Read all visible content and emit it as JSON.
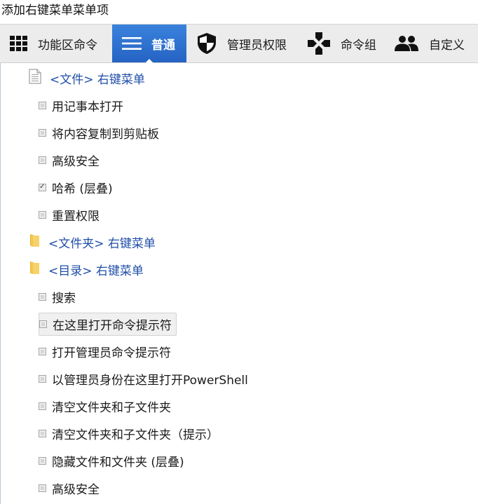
{
  "window": {
    "title": "添加右键菜单菜单项"
  },
  "toolbar": {
    "tabs": [
      {
        "label": "功能区命令",
        "icon": "grid-icon"
      },
      {
        "label": "普通",
        "icon": "hamburger-icon",
        "active": true
      },
      {
        "label": "管理员权限",
        "icon": "shield-icon"
      },
      {
        "label": "命令组",
        "icon": "dpad-icon"
      },
      {
        "label": "自定义",
        "icon": "people-icon"
      }
    ]
  },
  "groups": [
    {
      "label": "<文件> 右键菜单",
      "icon": "file-icon",
      "items": [
        {
          "label": "用记事本打开",
          "checked": false
        },
        {
          "label": "将内容复制到剪贴板",
          "checked": false
        },
        {
          "label": "高级安全",
          "checked": false
        },
        {
          "label": "哈希 (层叠)",
          "checked": true
        },
        {
          "label": "重置权限",
          "checked": false
        }
      ]
    },
    {
      "label": "<文件夹> 右键菜单",
      "icon": "folder-icon",
      "items": []
    },
    {
      "label": "<目录> 右键菜单",
      "icon": "folder-icon",
      "items": [
        {
          "label": "搜索",
          "checked": false
        },
        {
          "label": "在这里打开命令提示符",
          "checked": false,
          "hover": true
        },
        {
          "label": "打开管理员命令提示符",
          "checked": false
        },
        {
          "label": "以管理员身份在这里打开PowerShell",
          "checked": false
        },
        {
          "label": "清空文件夹和子文件夹",
          "checked": false
        },
        {
          "label": "清空文件夹和子文件夹（提示）",
          "checked": false
        },
        {
          "label": "隐藏文件和文件夹 (层叠)",
          "checked": false
        },
        {
          "label": "高级安全",
          "checked": false
        }
      ]
    }
  ],
  "colors": {
    "accent": "#2f74d0",
    "group_text": "#1f4ea8",
    "folder": "#f5c84a"
  }
}
